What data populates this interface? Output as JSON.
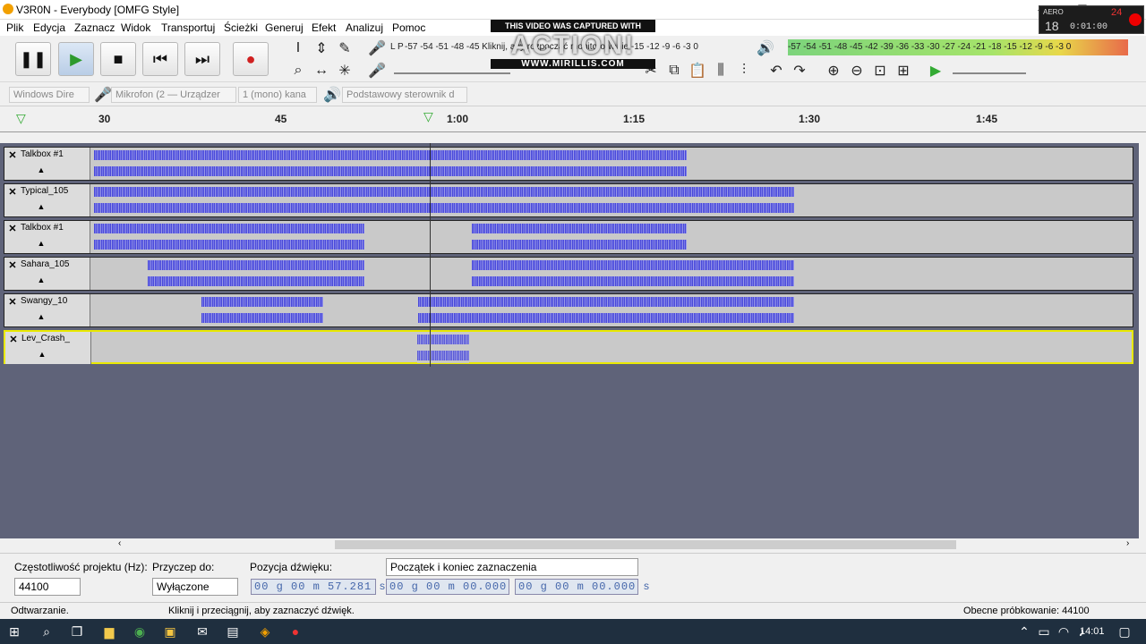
{
  "window": {
    "title": "V3R0N - Everybody [OMFG Style]",
    "minimize_icon": "minimize-icon",
    "maximize_icon": "maximize-icon",
    "close_icon": "close-icon"
  },
  "menu": [
    "Plik",
    "Edycja",
    "Zaznacz",
    "Widok",
    "Transportuj",
    "Ścieżki",
    "Generuj",
    "Efekt",
    "Analizuj",
    "Pomoc"
  ],
  "overlay": {
    "top": "THIS VIDEO WAS CAPTURED WITH",
    "logo": "ACTION!",
    "url": "WWW.MIRILLIS.COM"
  },
  "recorder": {
    "fps": "24",
    "big": "18",
    "time": "0:01:00",
    "label": "AERO"
  },
  "meters": {
    "rec_label": "L P",
    "rec_scale": "-57 -54 -51 -48 -45 Kliknij, aby rozpocząć monitorowanie -15 -12 -9 -6 -3 0",
    "play_scale": "-57 -54 -51 -48 -45 -42 -39 -36 -33 -30 -27 -24 -21 -18 -15 -12 -9 -6 -3 0"
  },
  "devices": {
    "host": "Windows Dire",
    "mic": "Mikrofon (2 — Urządzer",
    "channels": "1 (mono) kana",
    "output": "Podstawowy sterownik d"
  },
  "ruler": [
    "30",
    "45",
    "1:00",
    "1:15",
    "1:30",
    "1:45"
  ],
  "tracks": [
    {
      "name": "Talkbox #1"
    },
    {
      "name": "Typical_105"
    },
    {
      "name": "Talkbox #1"
    },
    {
      "name": "Sahara_105"
    },
    {
      "name": "Swangy_10"
    },
    {
      "name": "Lev_Crash_"
    }
  ],
  "selection_bar": {
    "rate_label": "Częstotliwość projektu (Hz):",
    "rate_value": "44100",
    "snap_label": "Przyczep do:",
    "snap_value": "Wyłączone",
    "pos_label": "Pozycja dźwięku:",
    "pos_value": "00 g 00 m 57.281 s",
    "sel_mode": "Początek i koniec zaznaczenia",
    "sel_start": "00 g 00 m 00.000 s",
    "sel_end": "00 g 00 m 00.000 s"
  },
  "status": {
    "state": "Odtwarzanie.",
    "hint": "Kliknij i przeciągnij, aby zaznaczyć dźwięk.",
    "rate": "Obecne próbkowanie: 44100"
  },
  "taskbar": {
    "clock": "14:01"
  }
}
